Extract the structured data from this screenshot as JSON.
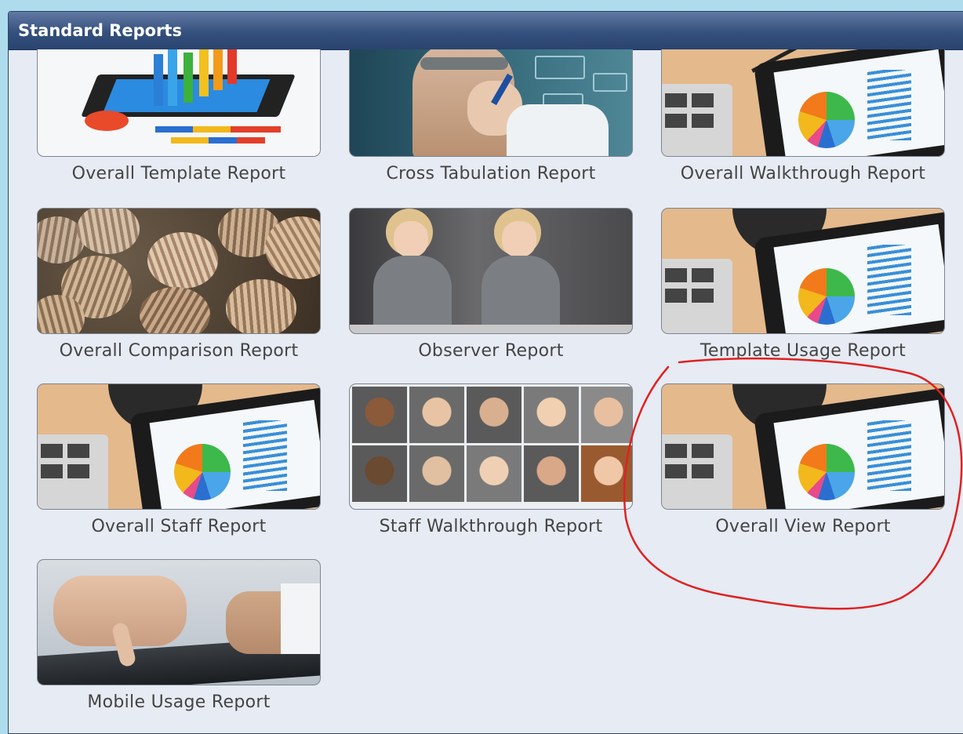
{
  "panel": {
    "title": "Standard Reports"
  },
  "reports": [
    {
      "label": "Overall Template Report",
      "image": "tablet-bar-chart-image"
    },
    {
      "label": "Cross Tabulation Report",
      "image": "person-drawing-diagram-image"
    },
    {
      "label": "Overall Walkthrough Report",
      "image": "calculator-tablet-pie-chart-image"
    },
    {
      "label": "Overall Comparison Report",
      "image": "seashells-image"
    },
    {
      "label": "Observer Report",
      "image": "women-with-tablets-image"
    },
    {
      "label": "Template Usage Report",
      "image": "calculator-tablet-pie-chart-image"
    },
    {
      "label": "Overall Staff Report",
      "image": "calculator-tablet-pie-chart-image"
    },
    {
      "label": "Staff Walkthrough Report",
      "image": "staff-portrait-grid-image"
    },
    {
      "label": "Overall View Report",
      "image": "calculator-tablet-pie-chart-image"
    },
    {
      "label": "Mobile Usage Report",
      "image": "hand-touching-tablet-image"
    }
  ],
  "annotation": {
    "color": "#e02020",
    "shape": "freehand-circle",
    "target": "Overall View Report"
  }
}
